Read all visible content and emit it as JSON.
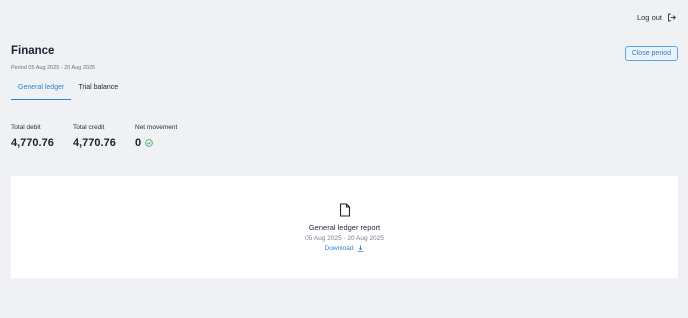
{
  "header": {
    "logout_label": "Log out"
  },
  "page": {
    "title": "Finance",
    "period": "Period 05 Aug 2025 - 20 Aug 2025",
    "close_period_label": "Close period"
  },
  "tabs": [
    {
      "label": "General ledger",
      "active": true
    },
    {
      "label": "Trial balance",
      "active": false
    }
  ],
  "stats": {
    "total_debit": {
      "label": "Total debit",
      "value": "4,770.76"
    },
    "total_credit": {
      "label": "Total credit",
      "value": "4,770.76"
    },
    "net_movement": {
      "label": "Net movement",
      "value": "0",
      "status_icon": "check-circle-icon"
    }
  },
  "report": {
    "icon": "document-icon",
    "title": "General ledger report",
    "dates": "05 Aug 2025 - 20 Aug 2025",
    "download_label": "Download",
    "download_icon": "download-icon"
  },
  "colors": {
    "accent": "#2d86cf",
    "success": "#3aa655",
    "background": "#f0f1f4"
  }
}
